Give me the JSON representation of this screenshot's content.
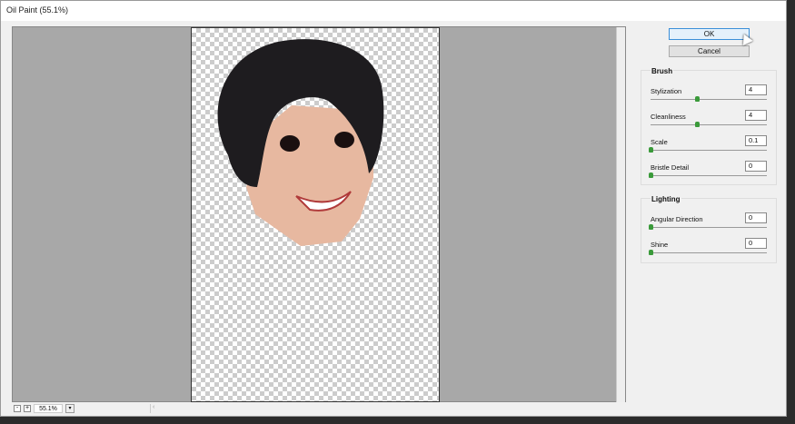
{
  "title": "Oil Paint (55.1%)",
  "buttons": {
    "ok": "OK",
    "cancel": "Cancel"
  },
  "preview": {
    "zoom": "55.1%",
    "zoom_out": "-",
    "zoom_in": "+"
  },
  "brush": {
    "title": "Brush",
    "controls": [
      {
        "label": "Stylization",
        "value": "4",
        "fraction": 0.4
      },
      {
        "label": "Cleanliness",
        "value": "4",
        "fraction": 0.4
      },
      {
        "label": "Scale",
        "value": "0.1",
        "fraction": 0.0
      },
      {
        "label": "Bristle Detail",
        "value": "0",
        "fraction": 0.0
      }
    ]
  },
  "lighting": {
    "title": "Lighting",
    "controls": [
      {
        "label": "Angular Direction",
        "value": "0",
        "fraction": 0.0
      },
      {
        "label": "Shine",
        "value": "0",
        "fraction": 0.0
      }
    ]
  }
}
